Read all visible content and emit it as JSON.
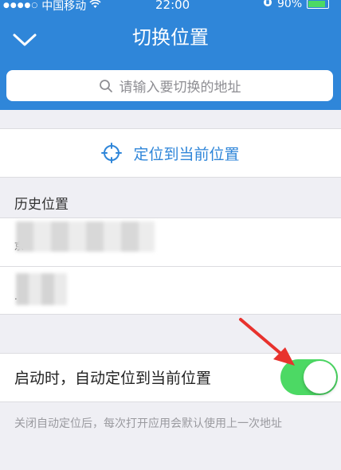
{
  "status_bar": {
    "carrier": "中国移动",
    "time": "22:00",
    "battery": "90%"
  },
  "header": {
    "title": "切换位置"
  },
  "search": {
    "placeholder": "请输入要切换的地址"
  },
  "locate": {
    "label": "定位到当前位置"
  },
  "history": {
    "section_label": "历史位置",
    "items": [
      {
        "visible_text": "京"
      },
      {
        "visible_text": "."
      }
    ]
  },
  "auto_locate": {
    "label": "启动时，自动定位到当前位置",
    "enabled": true
  },
  "hint": "关闭自动定位后，每次打开应用会默认使用上一次地址",
  "colors": {
    "brand_blue": "#2f86d9",
    "toggle_on": "#4cd964",
    "annotation_red": "#e8322d"
  }
}
